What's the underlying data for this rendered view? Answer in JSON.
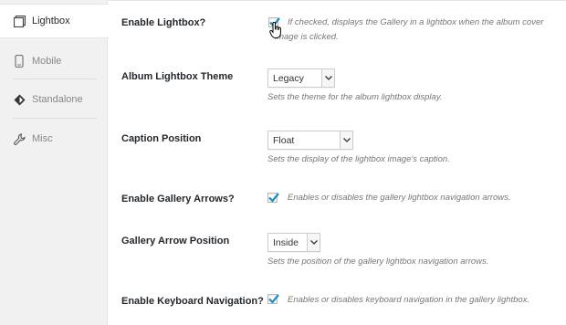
{
  "tabs": [
    {
      "label": "Lightbox",
      "icon": "gallery-icon",
      "active": true
    },
    {
      "label": "Mobile",
      "icon": "mobile-icon",
      "active": false
    },
    {
      "label": "Standalone",
      "icon": "diamond-icon",
      "active": false
    },
    {
      "label": "Misc",
      "icon": "wrench-icon",
      "active": false
    }
  ],
  "settings": {
    "enable_lightbox": {
      "label": "Enable Lightbox?",
      "checked": true,
      "desc_line1": "If checked, displays the Gallery in a lightbox when the album cover",
      "desc_line2": "image is clicked."
    },
    "album_theme": {
      "label": "Album Lightbox Theme",
      "value": "Legacy",
      "desc": "Sets the theme for the album lightbox display."
    },
    "caption_position": {
      "label": "Caption Position",
      "value": "Float",
      "desc": "Sets the display of the lightbox image's caption."
    },
    "gallery_arrows": {
      "label": "Enable Gallery Arrows?",
      "checked": true,
      "desc": "Enables or disables the gallery lightbox navigation arrows."
    },
    "arrow_position": {
      "label": "Gallery Arrow Position",
      "value": "Inside",
      "desc": "Sets the position of the gallery lightbox navigation arrows."
    },
    "keyboard_nav": {
      "label": "Enable Keyboard Navigation?",
      "checked": true,
      "desc": "Enables or disables keyboard navigation in the gallery lightbox."
    }
  },
  "colors": {
    "check": "#1e8cbe",
    "active_bg": "#ffffff",
    "tab_bg": "#f1f1f1"
  }
}
